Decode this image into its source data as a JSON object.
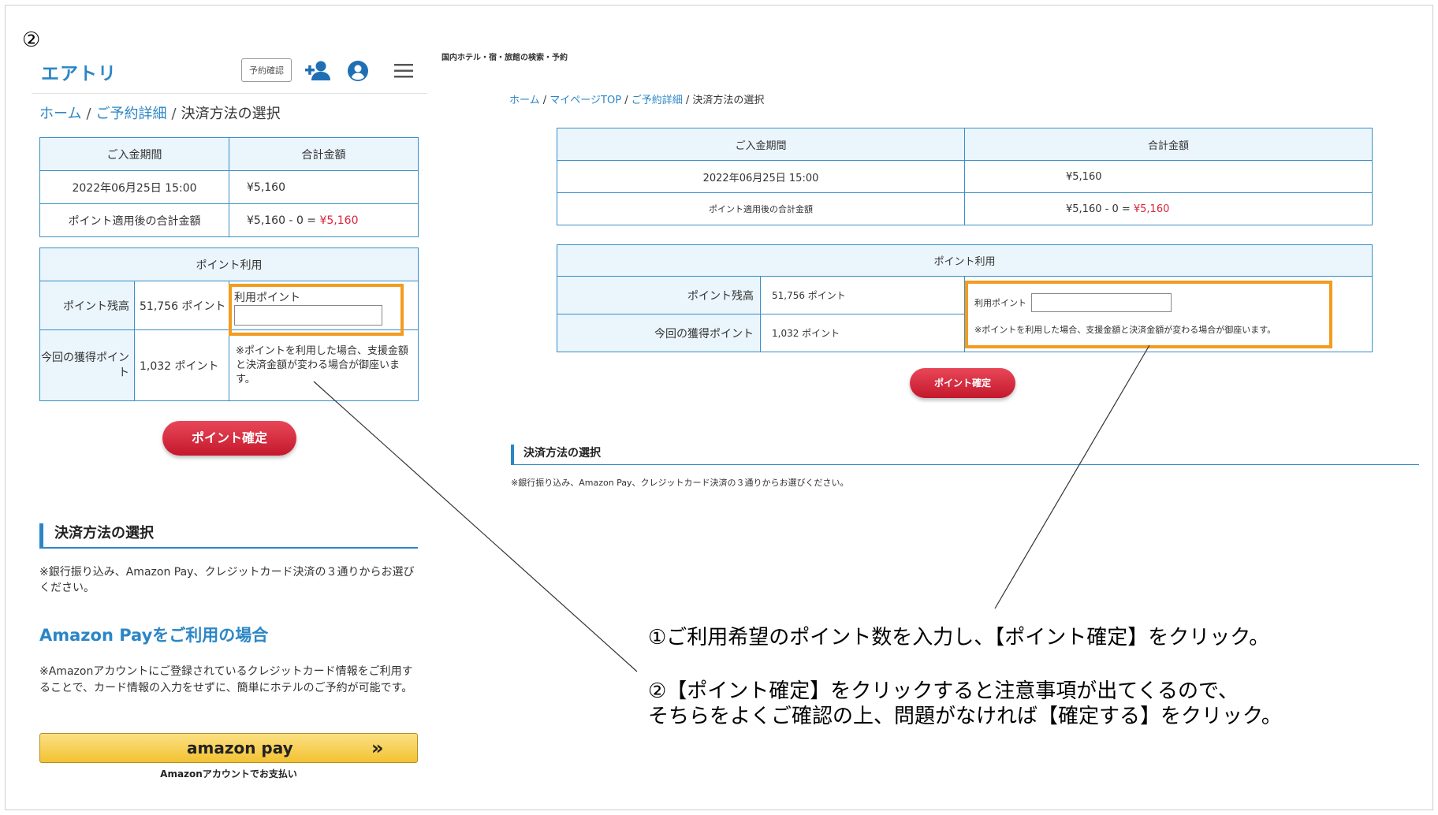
{
  "step_marker": "②",
  "mobile": {
    "logo": "エアトリ",
    "reservation_check": "予約確認",
    "breadcrumb": {
      "home": "ホーム",
      "sep": "/",
      "detail": "ご予約詳細",
      "current": "決済方法の選択"
    },
    "payment_table": {
      "headers": [
        "ご入金期間",
        "合計金額"
      ],
      "row1": {
        "label": "2022年06月25日 15:00",
        "value": "¥5,160"
      },
      "row2": {
        "label": "ポイント適用後の合計金額",
        "calc": "¥5,160 - 0 = ",
        "total": "¥5,160"
      }
    },
    "points_table": {
      "header": "ポイント利用",
      "balance_label": "ポイント残高",
      "balance_value": "51,756 ポイント",
      "use_label": "利用ポイント",
      "use_value": "",
      "earn_label": "今回の獲得ポイント",
      "earn_value": "1,032 ポイント",
      "note": "※ポイントを利用した場合、支援金額と決済金額が変わる場合が御座います。"
    },
    "confirm_button": "ポイント確定",
    "section_title": "決済方法の選択",
    "section_note": "※銀行振り込み、Amazon Pay、クレジットカード決済の３通りからお選びください。",
    "amazon_heading": "Amazon Payをご利用の場合",
    "amazon_text": "※Amazonアカウントにご登録されているクレジットカード情報をご利用することで、カード情報の入力をせずに、簡単にホテルのご予約が可能です。",
    "amazon_button_logo": "amazon pay",
    "amazon_button_chevron": "»",
    "amazon_caption": "Amazonアカウントでお支払い"
  },
  "desktop": {
    "site_header": "国内ホテル・宿・旅館の検索・予約",
    "breadcrumb": {
      "home": "ホーム",
      "sep": "/",
      "mypage": "マイページTOP",
      "detail": "ご予約詳細",
      "current": "決済方法の選択"
    },
    "payment_table": {
      "headers": [
        "ご入金期間",
        "合計金額"
      ],
      "row1": {
        "label": "2022年06月25日 15:00",
        "value": "¥5,160"
      },
      "row2": {
        "label": "ポイント適用後の合計金額",
        "calc": "¥5,160 - 0 = ",
        "total": "¥5,160"
      }
    },
    "points_table": {
      "header": "ポイント利用",
      "balance_label": "ポイント残高",
      "balance_value": "51,756 ポイント",
      "use_label": "利用ポイント",
      "use_value": "",
      "earn_label": "今回の獲得ポイント",
      "earn_value": "1,032 ポイント",
      "note": "※ポイントを利用した場合、支援金額と決済金額が変わる場合が御座います。"
    },
    "confirm_button": "ポイント確定",
    "section_title": "決済方法の選択",
    "section_note": "※銀行振り込み、Amazon Pay、クレジットカード決済の３通りからお選びください。"
  },
  "annotations": {
    "line1": "①ご利用希望のポイント数を入力し、【ポイント確定】をクリック。",
    "line2": "②【ポイント確定】をクリックすると注意事項が出てくるので、",
    "line3": "そちらをよくご確認の上、問題がなければ【確定する】をクリック。"
  },
  "colors": {
    "accent_blue": "#2b86c6",
    "highlight_orange": "#f39c1f",
    "button_red": "#d0212f",
    "amount_red": "#d7263d"
  }
}
